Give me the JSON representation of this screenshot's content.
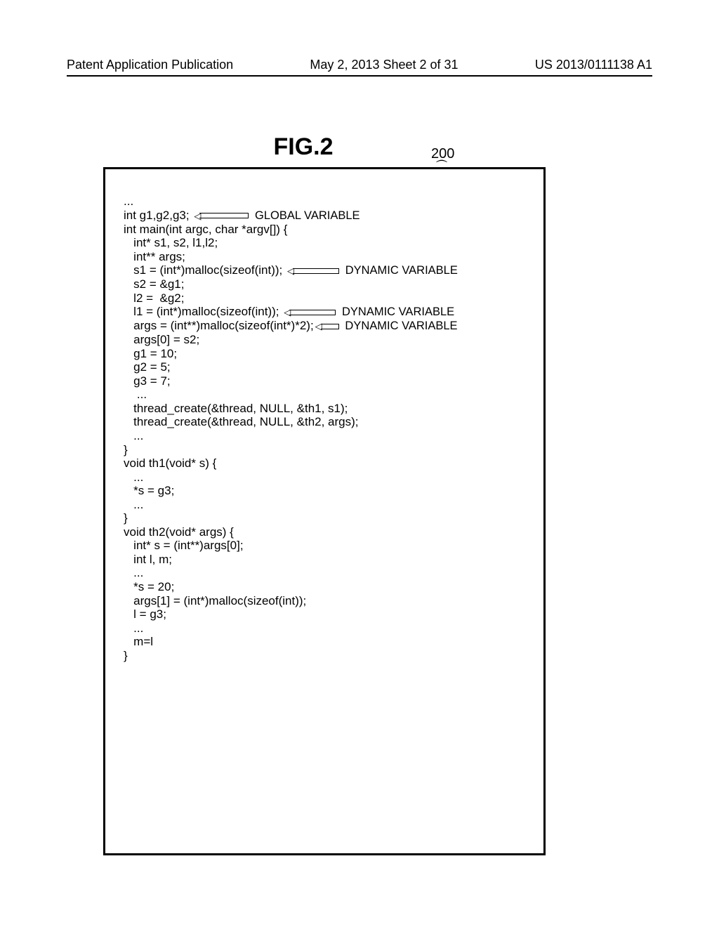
{
  "header": {
    "left": "Patent Application Publication",
    "center": "May 2, 2013  Sheet 2 of 31",
    "right": "US 2013/0111138 A1"
  },
  "figure": {
    "title": "FIG.2",
    "ref_num": "200",
    "ref_brace": "⏜"
  },
  "annotations": {
    "global_var": "GLOBAL VARIABLE",
    "dynamic_var": "DYNAMIC VARIABLE"
  },
  "code": {
    "l00": "...",
    "l01a": "int g1,g2,g3; ",
    "l02": "",
    "l03": "int main(int argc, char *argv[]) {",
    "l04": "   int* s1, s2, l1,l2;",
    "l05": "   int** args;",
    "l06a": "   s1 = (int*)malloc(sizeof(int)); ",
    "l07": "   s2 = &g1;",
    "l08": "   l2 =  &g2;",
    "l09a": "   l1 = (int*)malloc(sizeof(int)); ",
    "l10a": "   args = (int**)malloc(sizeof(int*)*2);",
    "l11": "   args[0] = s2;",
    "l12": "   g1 = 10;",
    "l13": "   g2 = 5;",
    "l14": "   g3 = 7;",
    "l15": "    ...",
    "l16": "   thread_create(&thread, NULL, &th1, s1);",
    "l17": "   thread_create(&thread, NULL, &th2, args);",
    "l18": "   ...",
    "l19": "}",
    "l20": "",
    "l21": "void th1(void* s) {",
    "l22": "   ...",
    "l23": "   *s = g3;",
    "l24": "   ...",
    "l25": "}",
    "l26": "",
    "l27": "void th2(void* args) {",
    "l28": "   int* s = (int**)args[0];",
    "l29": "   int l, m;",
    "l30": "   ...",
    "l31": "   *s = 20;",
    "l32": "   args[1] = (int*)malloc(sizeof(int));",
    "l33": "   l = g3;",
    "l34": "   ...",
    "l35": "   m=l",
    "l36": "}"
  }
}
